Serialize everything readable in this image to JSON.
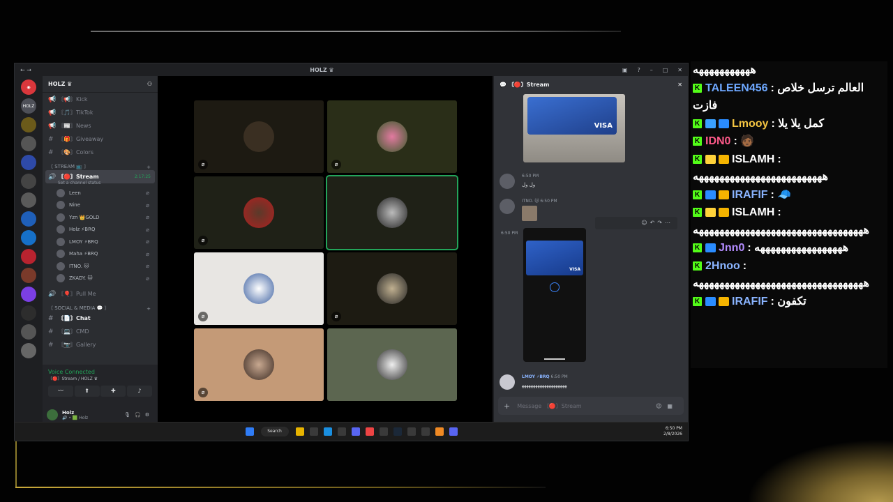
{
  "discord": {
    "window_title": "HOLZ ♛",
    "server_name": "HOLZ ♛",
    "server_icon_label": "HOLZ",
    "channels_top": [
      {
        "icon": "📢",
        "label": "〘📢〙Kick"
      },
      {
        "icon": "📢",
        "label": "〘🎵〙TikTok"
      },
      {
        "icon": "📢",
        "label": "〘📰〙News"
      },
      {
        "icon": "#",
        "label": "〘🎁〙Giveaway"
      },
      {
        "icon": "#",
        "label": "〘🎨〙Colors"
      }
    ],
    "category_stream": "〘 STREAM 📺 〙",
    "voice_channel": {
      "label": "〘🔴〙Stream",
      "timer": "2:17:25",
      "status": "Set a channel status"
    },
    "voice_users": [
      {
        "name": "Leen"
      },
      {
        "name": "Nine"
      },
      {
        "name": "Yzn 👑GOLD"
      },
      {
        "name": "Holz ⚡BRQ"
      },
      {
        "name": "LMOY ⚡BRQ"
      },
      {
        "name": "Maha ⚡BRQ"
      },
      {
        "name": "ITNO. 🐱"
      },
      {
        "name": "ZKADY. 🐱"
      }
    ],
    "pull_me": "〘🎈〙Pull Me",
    "category_social": "〘 SOCIAL & MEDIA 💬 〙",
    "channels_bottom": [
      {
        "icon": "#",
        "label": "〘📄〙Chat"
      },
      {
        "icon": "#",
        "label": "〘💻〙CMD"
      },
      {
        "icon": "#",
        "label": "〘📷〙Gallery"
      }
    ],
    "voice_connected": {
      "title": "Voice Connected",
      "subtitle": "〘🔴〙Stream / HOLZ ♛"
    },
    "user": {
      "name": "Holz",
      "tag": "🔊 • 🟩 Holz"
    },
    "chat": {
      "title": "〘🔴〙Stream",
      "msg1": {
        "author": "",
        "time": "6:50 PM",
        "text": "ول ول"
      },
      "msg2": {
        "author": "ITNO. 🐱",
        "time": "6:50 PM"
      },
      "img_time": "6:50 PM",
      "msg3": {
        "author": "LMOY ⚡BRQ",
        "time": "6:50 PM",
        "text": "ﻬﻬﻬﻬﻬﻬﻬﻬﻬﻬﻬﻬﻬﻬﻬﻬﻬﻬﻬﻬ"
      },
      "composer_placeholder": "Message 〘🔴〙Stream",
      "card_label": "VISA"
    },
    "taskbar": {
      "search": "Search",
      "time": "6:50 PM",
      "date": "2/8/2026"
    }
  },
  "twitch_chat": [
    {
      "user": "",
      "text": "هههههههههههه",
      "badges": []
    },
    {
      "user": "TALEEN456",
      "text": "العالم ترسل خلاص فازت",
      "color": "#6ea8ff",
      "badges": [
        "kick"
      ]
    },
    {
      "user": "Lmooy",
      "text": "كمل يلا يلا",
      "color": "#f5c542",
      "badges": [
        "kick",
        "wave",
        "bolt"
      ]
    },
    {
      "user": "IDN0",
      "text": "🧑🏾",
      "color": "#ff5a8a",
      "badges": [
        "kick"
      ]
    },
    {
      "user": "ISLAMH",
      "text": "هههههههههههههههههههههههههه",
      "color": "#ffffff",
      "badges": [
        "kick",
        "lightning",
        "crown"
      ]
    },
    {
      "user": "IRAFIF",
      "text": "🧢",
      "color": "#8ab4ff",
      "badges": [
        "kick",
        "plane",
        "crown"
      ]
    },
    {
      "user": "ISLAMH",
      "text": "هههههههههههههههههههههههههههههههههه",
      "color": "#ffffff",
      "badges": [
        "kick",
        "lightning",
        "crown"
      ]
    },
    {
      "user": "Jnn0",
      "text": "هههههههههههههههههه",
      "color": "#b38cff",
      "badges": [
        "kick",
        "bolt"
      ]
    },
    {
      "user": "2Hnoo",
      "text": "هههههههههههههههههههههههههههههههههه",
      "color": "#8ab4ff",
      "badges": [
        "kick"
      ]
    },
    {
      "user": "IRAFIF",
      "text": "تكفون",
      "color": "#8ab4ff",
      "badges": [
        "kick",
        "plane",
        "crown"
      ]
    }
  ],
  "colors": {
    "kick_green": "#53fc18",
    "speaking": "#23a55a",
    "gold": "#c9a93a"
  }
}
